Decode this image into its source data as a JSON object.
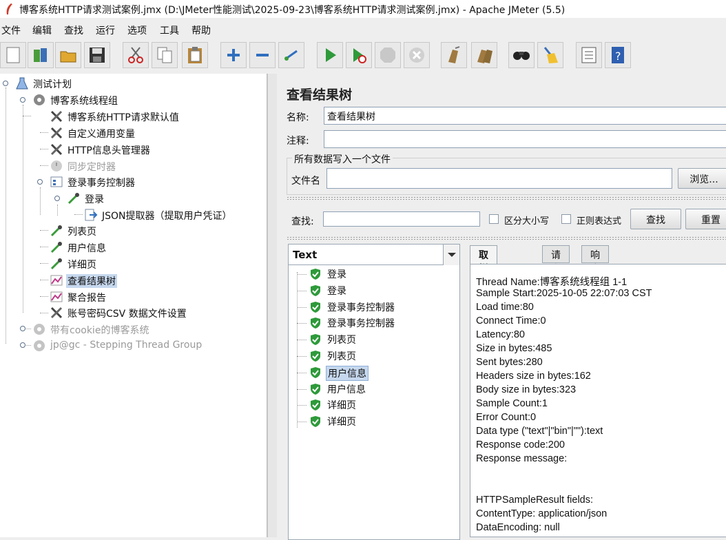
{
  "window": {
    "title": "博客系统HTTP请求测试案例.jmx (D:\\JMeter性能测试\\2025-09-23\\博客系统HTTP请求测试案例.jmx) - Apache JMeter (5.5)"
  },
  "menu": [
    "文件",
    "编辑",
    "查找",
    "运行",
    "选项",
    "工具",
    "帮助"
  ],
  "toolbar": {
    "icons": [
      "new-icon",
      "templates-icon",
      "open-icon",
      "save-icon",
      "cut-icon",
      "copy-icon",
      "paste-icon",
      "expand-icon",
      "collapse-icon",
      "toggle-icon",
      "start-icon",
      "start-no-timers-icon",
      "stop-icon",
      "shutdown-icon",
      "clear-icon",
      "clear-all-icon",
      "search-icon",
      "reset-search-icon",
      "function-helper-icon",
      "help-icon"
    ]
  },
  "tree": {
    "nodes": [
      {
        "label": "测试计划"
      },
      {
        "label": "博客系统线程组"
      },
      {
        "label": "博客系统HTTP请求默认值"
      },
      {
        "label": "自定义通用变量"
      },
      {
        "label": "HTTP信息头管理器"
      },
      {
        "label": "同步定时器"
      },
      {
        "label": "登录事务控制器"
      },
      {
        "label": "登录"
      },
      {
        "label": "JSON提取器（提取用户凭证）"
      },
      {
        "label": "列表页"
      },
      {
        "label": "用户信息"
      },
      {
        "label": "详细页"
      },
      {
        "label": "查看结果树"
      },
      {
        "label": "聚合报告"
      },
      {
        "label": "账号密码CSV 数据文件设置"
      },
      {
        "label": "带有cookie的博客系统"
      },
      {
        "label": "jp@gc - Stepping Thread Group"
      }
    ]
  },
  "panel": {
    "title": "查看结果树",
    "name_label": "名称:",
    "name_value": "查看结果树",
    "comment_label": "注释:",
    "comment_value": "",
    "file_group_label": "所有数据写入一个文件",
    "filename_label": "文件名",
    "filename_value": "",
    "browse_label": "浏览...",
    "search_label": "查找:",
    "search_value": "",
    "case_label": "区分大小写",
    "regex_label": "正则表达式",
    "find_label": "查找",
    "reset_label": "重置"
  },
  "results": {
    "renderer": "Text",
    "items": [
      "登录",
      "登录",
      "登录事务控制器",
      "登录事务控制器",
      "列表页",
      "列表页",
      "用户信息",
      "用户信息",
      "详细页",
      "详细页"
    ],
    "selected_index": 6
  },
  "tabs": [
    "取样器结果",
    "请求",
    "响应数据"
  ],
  "sampler_result": {
    "lines": [
      "Thread Name:博客系统线程组 1-1",
      "Sample Start:2025-10-05 22:07:03 CST",
      "Load time:80",
      "Connect Time:0",
      "Latency:80",
      "Size in bytes:485",
      "Sent bytes:280",
      "Headers size in bytes:162",
      "Body size in bytes:323",
      "Sample Count:1",
      "Error Count:0",
      "Data type (\"text\"|\"bin\"|\"\"):text",
      "Response code:200",
      "Response message:",
      "",
      "",
      "HTTPSampleResult fields:",
      "ContentType: application/json",
      "DataEncoding: null"
    ]
  },
  "colors": {
    "selection": "#c6d8ee",
    "success_green": "#2e9a3a",
    "disabled_text": "#9a9a9a"
  }
}
